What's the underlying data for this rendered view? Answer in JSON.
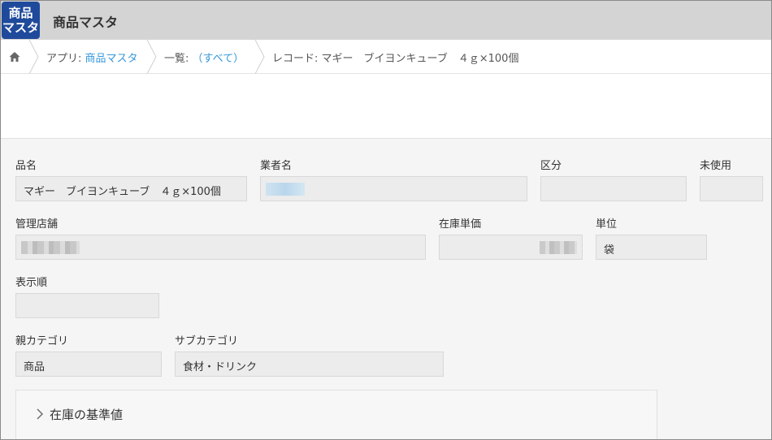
{
  "header": {
    "app_icon_text": "商品\nマスタ",
    "app_title": "商品マスタ"
  },
  "breadcrumb": {
    "app_prefix": "アプリ: ",
    "app_link": "商品マスタ",
    "list_prefix": "一覧: ",
    "list_link": "（すべて）",
    "record": "レコード: マギー　ブイヨンキューブ　４ｇ×100個"
  },
  "fields": {
    "product_name": {
      "label": "品名",
      "value": "マギー　ブイヨンキューブ　４ｇ×100個"
    },
    "vendor_name": {
      "label": "業者名",
      "value": ""
    },
    "category_kubun": {
      "label": "区分",
      "value": ""
    },
    "unused": {
      "label": "未使用",
      "value": ""
    },
    "managing_store": {
      "label": "管理店舗",
      "value": ""
    },
    "stock_unit_price": {
      "label": "在庫単価",
      "value": ""
    },
    "unit": {
      "label": "単位",
      "value": "袋"
    },
    "display_order": {
      "label": "表示順",
      "value": ""
    },
    "parent_category": {
      "label": "親カテゴリ",
      "value": "商品"
    },
    "sub_category": {
      "label": "サブカテゴリ",
      "value": "食材・ドリンク"
    }
  },
  "section": {
    "title": "在庫の基準値"
  },
  "colors": {
    "brand": "#1f4a9c",
    "link": "#3498db",
    "header_bg": "#d4d4d4"
  }
}
